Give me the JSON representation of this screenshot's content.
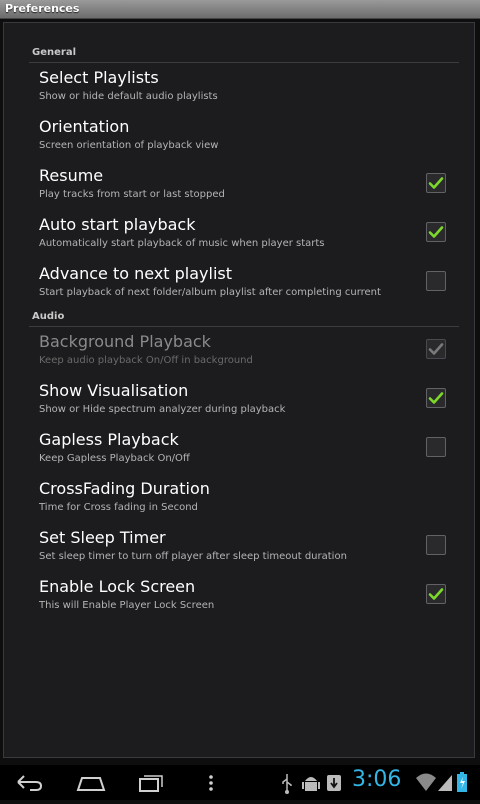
{
  "window": {
    "title": "Preferences"
  },
  "colors": {
    "accent": "#33b5e5",
    "check": "#7cd82a"
  },
  "categories": [
    {
      "label": "General",
      "items": [
        {
          "title": "Select Playlists",
          "summary": "Show or hide default audio playlists",
          "checkbox": "none",
          "enabled": true
        },
        {
          "title": "Orientation",
          "summary": "Screen orientation of playback view",
          "checkbox": "none",
          "enabled": true
        },
        {
          "title": "Resume",
          "summary": "Play tracks from start or last stopped",
          "checkbox": "checked",
          "enabled": true
        },
        {
          "title": "Auto start playback",
          "summary": "Automatically start playback of music when player starts",
          "checkbox": "checked",
          "enabled": true
        },
        {
          "title": "Advance to next playlist",
          "summary": "Start playback of next folder/album playlist after completing current",
          "checkbox": "unchecked",
          "enabled": true
        }
      ]
    },
    {
      "label": "Audio",
      "items": [
        {
          "title": "Background Playback",
          "summary": "Keep audio playback On/Off in background",
          "checkbox": "checked",
          "enabled": false
        },
        {
          "title": "Show Visualisation",
          "summary": "Show or Hide spectrum analyzer during playback",
          "checkbox": "checked",
          "enabled": true
        },
        {
          "title": "Gapless Playback",
          "summary": "Keep Gapless Playback On/Off",
          "checkbox": "unchecked",
          "enabled": true
        },
        {
          "title": "CrossFading Duration",
          "summary": "Time for Cross fading in Second",
          "checkbox": "none",
          "enabled": true
        },
        {
          "title": "Set Sleep Timer",
          "summary": "Set sleep timer to turn off player after sleep timeout duration",
          "checkbox": "unchecked",
          "enabled": true
        },
        {
          "title": "Enable Lock Screen",
          "summary": "This will Enable Player Lock Screen",
          "checkbox": "checked",
          "enabled": true
        }
      ]
    }
  ],
  "navbar": {
    "buttons": [
      "back-icon",
      "home-icon",
      "recent-apps-icon",
      "menu-icon"
    ],
    "status_icons": [
      "usb-icon",
      "android-debug-icon",
      "download-icon",
      "wifi-icon",
      "signal-icon",
      "battery-icon"
    ],
    "clock": "3:06"
  }
}
